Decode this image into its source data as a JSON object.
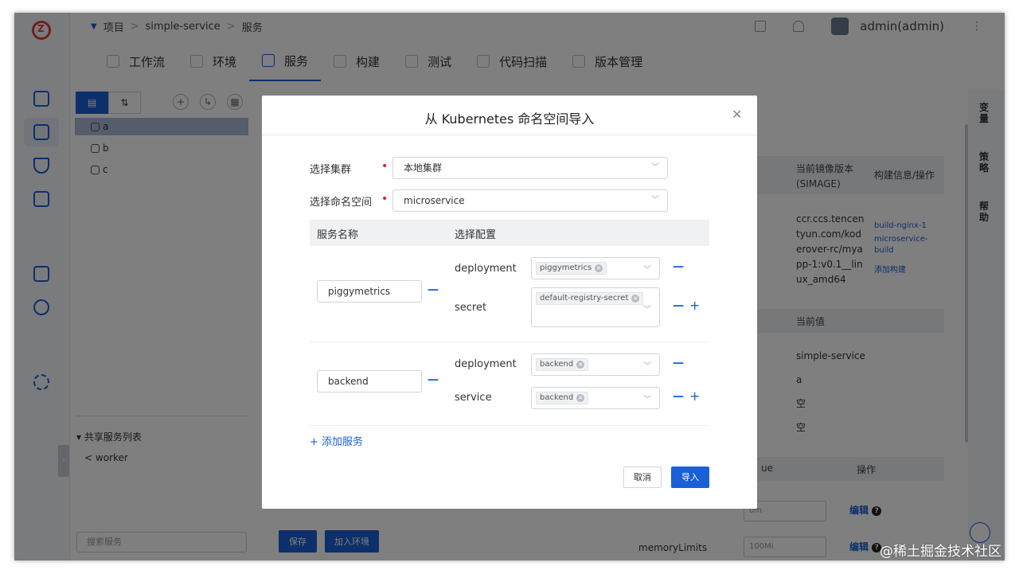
{
  "breadcrumb": {
    "items": [
      "项目",
      "simple-service",
      "服务"
    ]
  },
  "header": {
    "user": "admin(admin)"
  },
  "tabs": [
    {
      "label": "工作流",
      "icon": "workflow-icon"
    },
    {
      "label": "环境",
      "icon": "environment-icon"
    },
    {
      "label": "服务",
      "icon": "service-icon",
      "active": true
    },
    {
      "label": "构建",
      "icon": "build-icon"
    },
    {
      "label": "测试",
      "icon": "test-icon"
    },
    {
      "label": "代码扫描",
      "icon": "scan-icon"
    },
    {
      "label": "版本管理",
      "icon": "version-icon"
    }
  ],
  "left_panel": {
    "services": [
      "a",
      "b",
      "c"
    ],
    "shared_title": "共享服务列表",
    "shared_items": [
      "worker"
    ],
    "search_placeholder": "搜索服务"
  },
  "middle": {
    "save_label": "保存",
    "join_env_label": "加入环境"
  },
  "right_panel": {
    "col_current_image": "当前镜像版本 (SIMAGE)",
    "col_build_info": "构建信息/操作",
    "image_value": "ccr.ccs.tencentyun.com/koderover-rc/myapp-1:v0.1__linux_amd64",
    "build_links": [
      "build-nginx-1",
      "microservice-build"
    ],
    "add_build": "添加构建",
    "col_current_value": "当前值",
    "values": [
      "simple-service",
      "a",
      "空",
      "空"
    ],
    "col_value": "ue",
    "col_ops": "操作",
    "row1_input": "0m",
    "row2_label": "memoryLimits",
    "row2_input": "100Mi",
    "edit_label": "编辑",
    "side_tabs": [
      "变量",
      "策略",
      "帮助"
    ]
  },
  "modal": {
    "title": "从 Kubernetes 命名空间导入",
    "cluster_label": "选择集群",
    "cluster_value": "本地集群",
    "namespace_label": "选择命名空间",
    "namespace_value": "microservice",
    "table_header_name": "服务名称",
    "table_header_config": "选择配置",
    "services": [
      {
        "name": "piggymetrics",
        "configs": [
          {
            "kind": "deployment",
            "tag": "piggymetrics"
          },
          {
            "kind": "secret",
            "tag": "default-registry-secret"
          }
        ]
      },
      {
        "name": "backend",
        "configs": [
          {
            "kind": "deployment",
            "tag": "backend"
          },
          {
            "kind": "service",
            "tag": "backend"
          }
        ]
      }
    ],
    "add_service_label": "添加服务",
    "cancel_label": "取消",
    "import_label": "导入"
  },
  "watermark": "@稀土掘金技术社区",
  "colors": {
    "accent": "#1b5fd6",
    "required": "#e02020",
    "logo": "#e0413b"
  }
}
